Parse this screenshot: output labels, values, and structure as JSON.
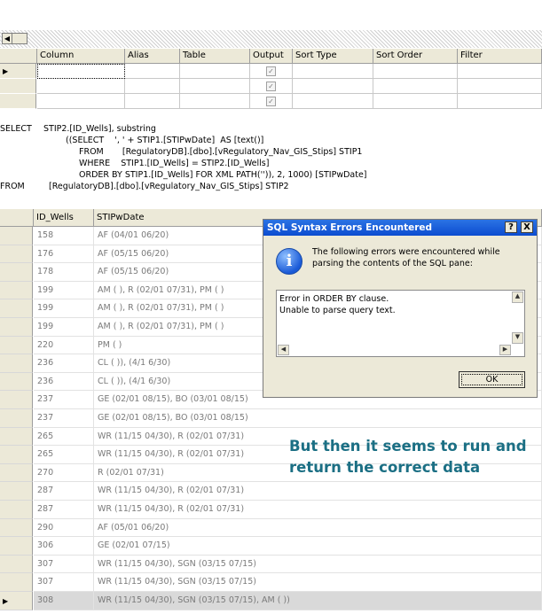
{
  "criteria": {
    "columns": [
      "Column",
      "Alias",
      "Table",
      "Output",
      "Sort Type",
      "Sort Order",
      "Filter"
    ],
    "output_checked": [
      true,
      true,
      true
    ]
  },
  "sql": {
    "lines": [
      {
        "kw": "SELECT",
        "text": "STIP2.[ID_Wells], substring"
      },
      {
        "kw": "",
        "text": "((SELECT    ', ' + STIP1.[STIPwDate]  AS [text()]"
      },
      {
        "kw": "",
        "text": "FROM       [RegulatoryDB].[dbo].[vRegulatory_Nav_GIS_Stips] STIP1"
      },
      {
        "kw": "",
        "text": "WHERE    STIP1.[ID_Wells] = STIP2.[ID_Wells]"
      },
      {
        "kw": "",
        "text": "ORDER BY STIP1.[ID_Wells] FOR XML PATH('')), 2, 1000) [STIPwDate]"
      },
      {
        "kw": "FROM",
        "text": "[RegulatoryDB].[dbo].[vRegulatory_Nav_GIS_Stips] STIP2"
      }
    ]
  },
  "results": {
    "columns": [
      "ID_Wells",
      "STIPwDate"
    ],
    "rows": [
      [
        "158",
        "AF  (04/01 06/20)"
      ],
      [
        "176",
        "AF  (05/15 06/20)"
      ],
      [
        "178",
        "AF  (05/15 06/20)"
      ],
      [
        "199",
        "AM  ( ), R  (02/01 07/31), PM  ( )"
      ],
      [
        "199",
        "AM  ( ), R  (02/01 07/31), PM  ( )"
      ],
      [
        "199",
        "AM  ( ), R  (02/01 07/31), PM  ( )"
      ],
      [
        "220",
        "PM  ( )"
      ],
      [
        "236",
        "CL  (  )),     (4/1 6/30)"
      ],
      [
        "236",
        "CL  (  )),     (4/1 6/30)"
      ],
      [
        "237",
        "GE  (02/01 08/15), BO  (03/01 08/15)"
      ],
      [
        "237",
        "GE  (02/01 08/15), BO  (03/01 08/15)"
      ],
      [
        "265",
        "WR  (11/15 04/30), R  (02/01 07/31)"
      ],
      [
        "265",
        "WR  (11/15 04/30), R  (02/01 07/31)"
      ],
      [
        "270",
        "R  (02/01 07/31)"
      ],
      [
        "287",
        "WR  (11/15 04/30), R  (02/01 07/31)"
      ],
      [
        "287",
        "WR  (11/15 04/30), R  (02/01 07/31)"
      ],
      [
        "290",
        "AF  (05/01 06/20)"
      ],
      [
        "306",
        "GE  (02/01 07/15)"
      ],
      [
        "307",
        "WR  (11/15 04/30), SGN  (03/15 07/15)"
      ],
      [
        "307",
        "WR  (11/15 04/30), SGN  (03/15 07/15)"
      ],
      [
        "308",
        "WR  (11/15 04/30), SGN  (03/15 07/15), AM  (  ))"
      ]
    ]
  },
  "dialog": {
    "title": "SQL Syntax Errors Encountered",
    "help_label": "?",
    "close_label": "X",
    "message": "The following errors were encountered while parsing the contents of the SQL pane:",
    "error_text": "Error in ORDER BY clause.\nUnable to parse query text.",
    "ok_label": "OK"
  },
  "annotation": "But then it seems to run and return the correct data",
  "colors": {
    "chrome": "#ece9d8",
    "title_bar": "#0c4cd0",
    "annotation": "#1b6f84",
    "selected_row": "#d9d9d9"
  }
}
